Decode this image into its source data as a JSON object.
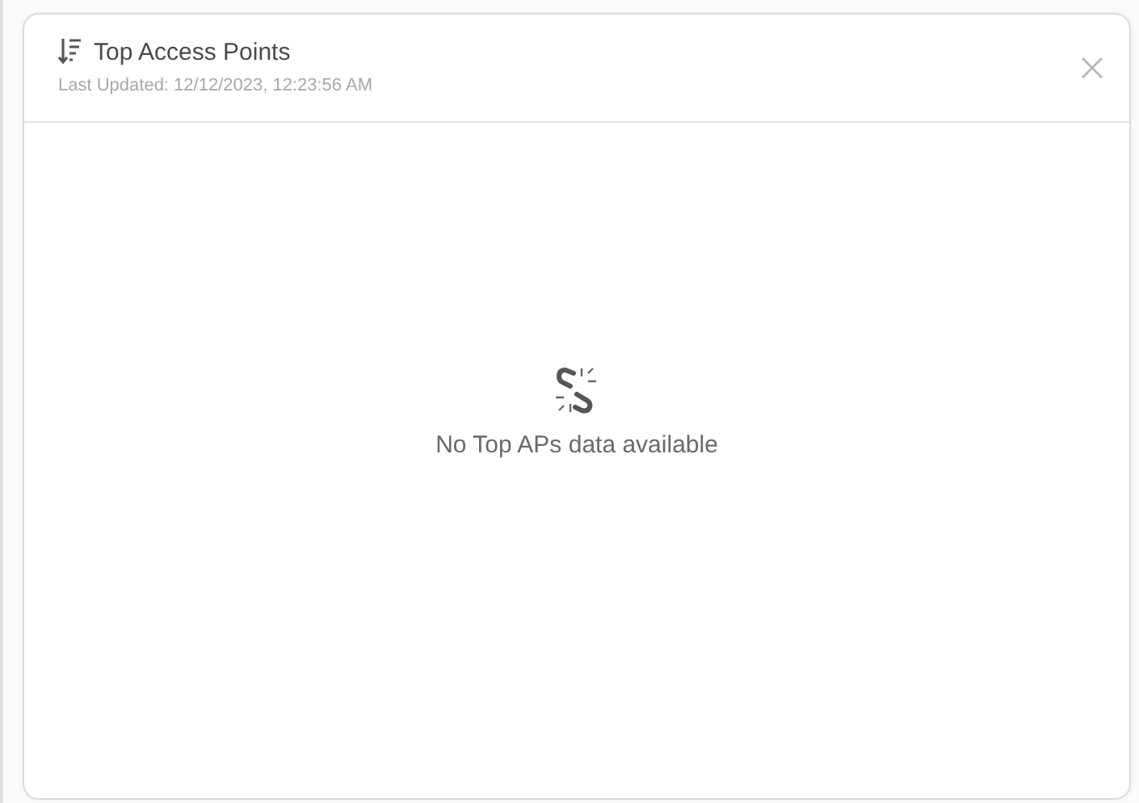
{
  "card": {
    "title": "Top Access Points",
    "subtitle": "Last Updated: 12/12/2023, 12:23:56 AM",
    "empty_message": "No Top APs data available"
  }
}
